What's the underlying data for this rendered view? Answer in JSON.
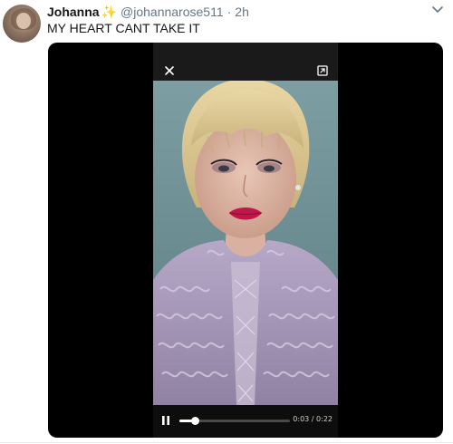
{
  "tweet": {
    "author_name": "Johanna",
    "name_emoji": "✨",
    "handle": "@johannarose511",
    "separator": "·",
    "timestamp": "2h",
    "text": "MY HEART CANT TAKE IT"
  },
  "video_player": {
    "playback_state": "paused-icon-shown",
    "current_time": "0:03",
    "duration": "0:22",
    "time_display": "0:03 / 0:22",
    "progress_percent": 14
  },
  "colors": {
    "name_text": "#14171a",
    "secondary_text": "#657786",
    "media_background": "#000000",
    "sparkle": "#f5b800"
  },
  "icons": {
    "close": "close-icon",
    "pip": "picture-in-picture-icon",
    "pause": "pause-icon",
    "menu": "chevron-down-icon"
  }
}
